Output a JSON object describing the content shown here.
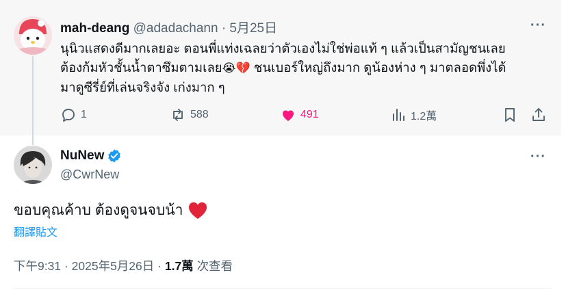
{
  "quoted_tweet": {
    "display_name": "mah-deang",
    "handle": "@adadachann",
    "separator": "·",
    "date": "5月25日",
    "text_line1": "นุนิวแสดงดีมากเลยอะ ตอนพี่แท่งเฉลยว่าตัวเองไม่ใช่พ่อแท้ ๆ แล้วเป็นสามัญชนเลย",
    "text_line2_a": "ต้องก้มหัวชั้นน้ำตาซึมตามเลย",
    "text_line2_b": " ชนเบอร์ใหญ่ถึงมาก ดูน้องห่าง ๆ มาตลอดพึ่งได้",
    "text_line3": "มาดูซีรี่ย์ที่เล่นจริงจัง เก่งมาก ๆ",
    "emojis": [
      "😭",
      "💔"
    ],
    "replies": "1",
    "reposts": "588",
    "likes": "491",
    "views": "1.2萬",
    "more": "···"
  },
  "main_tweet": {
    "display_name": "NuNew",
    "handle": "@CwrNew",
    "text": "ขอบคุณค้าบ ต้องดูจนจบน้า",
    "translate_label": "翻譯貼文",
    "time": "下午9:31",
    "separator": "·",
    "date": "2025年5月26日",
    "views_count": "1.7萬",
    "views_label": "次查看",
    "more": "···"
  },
  "colors": {
    "like_pink": "#f91880",
    "verified_blue": "#1d9bf0",
    "link_blue": "#1d9bf0",
    "muted": "#536471",
    "heart_red": "#e0253b"
  }
}
